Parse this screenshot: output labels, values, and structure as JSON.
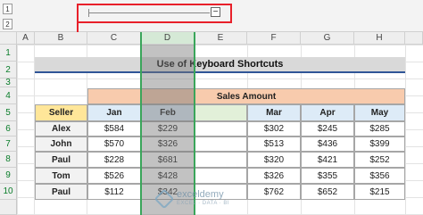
{
  "outline": {
    "level1": "1",
    "level2": "2",
    "minus_symbol": "−"
  },
  "columns": [
    "A",
    "B",
    "C",
    "D",
    "E",
    "F",
    "G",
    "H"
  ],
  "rows": [
    "1",
    "2",
    "3",
    "4",
    "5",
    "6",
    "7",
    "8",
    "9",
    "10"
  ],
  "title": "Use of Keyboard Shortcuts",
  "sales_amount_header": "Sales Amount",
  "headers": {
    "seller": "Seller",
    "jan": "Jan",
    "feb": "Feb",
    "mar": "Mar",
    "apr": "Apr",
    "may": "May"
  },
  "table": [
    {
      "seller": "Alex",
      "jan": "$584",
      "feb": "$229",
      "mar": "$302",
      "apr": "$245",
      "may": "$285"
    },
    {
      "seller": "John",
      "jan": "$570",
      "feb": "$326",
      "mar": "$513",
      "apr": "$436",
      "may": "$399"
    },
    {
      "seller": "Paul",
      "jan": "$228",
      "feb": "$681",
      "mar": "$320",
      "apr": "$421",
      "may": "$252"
    },
    {
      "seller": "Tom",
      "jan": "$526",
      "feb": "$428",
      "mar": "$326",
      "apr": "$355",
      "may": "$356"
    },
    {
      "seller": "Paul",
      "jan": "$112",
      "feb": "$342",
      "mar": "$762",
      "apr": "$652",
      "may": "$215"
    }
  ],
  "watermark": {
    "name": "exceldemy",
    "tagline": "EXCEL · DATA · BI"
  },
  "colors": {
    "header_orange": "#f8cbad",
    "seller_yellow": "#ffe699",
    "col_header_blue": "#ddebf7",
    "seller_cell": "#f2f2f2",
    "grey_col": "#a6a6a6",
    "annotation_red": "#e8202a",
    "group_green": "#3aa55a"
  }
}
